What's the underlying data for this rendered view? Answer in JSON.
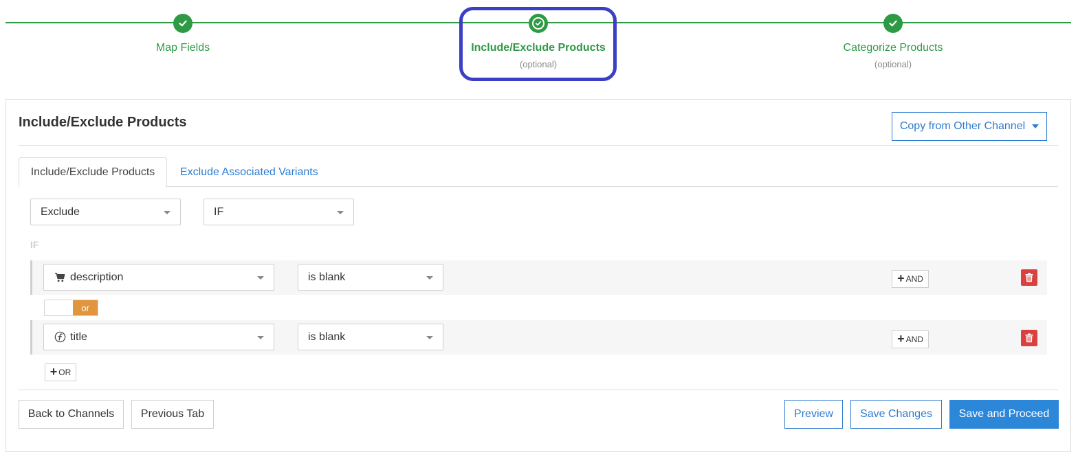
{
  "stepper": {
    "steps": [
      {
        "label": "Map Fields",
        "sub": ""
      },
      {
        "label": "Include/Exclude Products",
        "sub": "(optional)"
      },
      {
        "label": "Categorize Products",
        "sub": "(optional)"
      }
    ],
    "accent_color": "#2f9a46",
    "highlight_color": "#3b3fc4"
  },
  "panel": {
    "title": "Include/Exclude Products",
    "copy_button": "Copy from Other Channel",
    "tabs": [
      {
        "label": "Include/Exclude Products",
        "active": true
      },
      {
        "label": "Exclude Associated Variants",
        "active": false
      }
    ],
    "action_select": "Exclude",
    "logic_select": "IF",
    "if_label": "IF",
    "conditions": [
      {
        "field": "description",
        "field_icon": "cart-icon",
        "operator": "is blank",
        "and_label": "AND"
      },
      {
        "field": "title",
        "field_icon": "function-icon",
        "operator": "is blank",
        "and_label": "AND"
      }
    ],
    "toggle_label": "or",
    "or_button": "OR"
  },
  "footer": {
    "back_button": "Back to Channels",
    "previous_button": "Previous Tab",
    "preview_button": "Preview",
    "save_button": "Save Changes",
    "save_proceed_button": "Save and Proceed"
  },
  "colors": {
    "primary": "#2d87d8",
    "link": "#2d7ccf",
    "danger": "#d9413e",
    "toggle": "#e1963d"
  }
}
